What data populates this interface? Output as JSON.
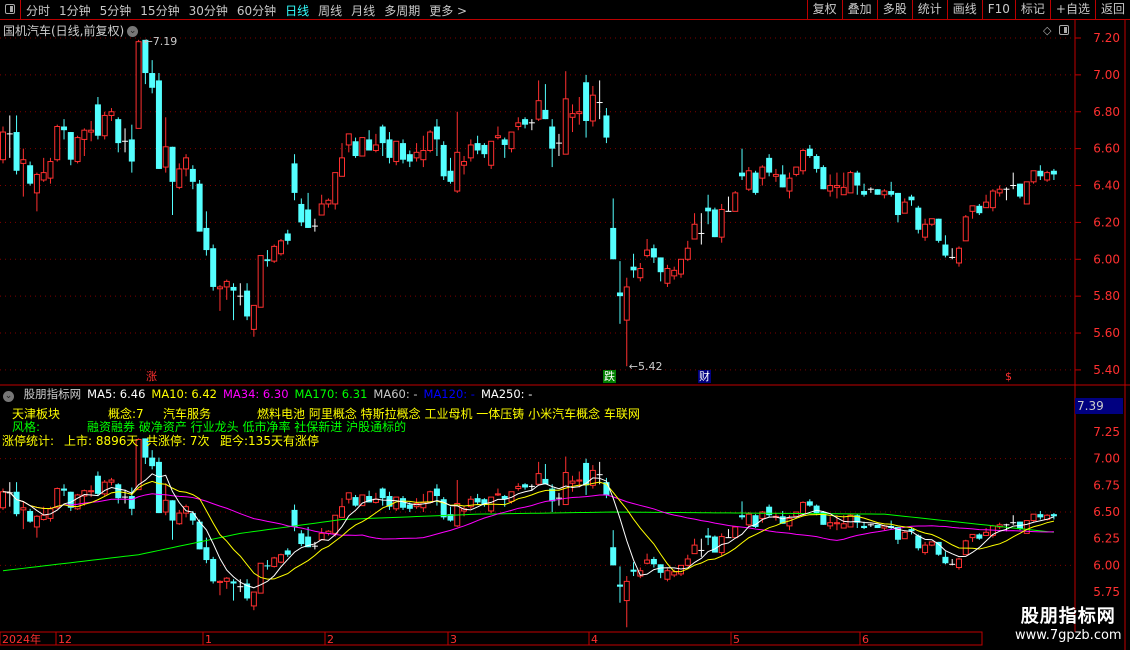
{
  "toolbar": {
    "periods": [
      "分时",
      "1分钟",
      "5分钟",
      "15分钟",
      "30分钟",
      "60分钟",
      "日线",
      "周线",
      "月线",
      "多周期",
      "更多 >"
    ],
    "active_period": "日线",
    "buttons": [
      "复权",
      "叠加",
      "多股",
      "统计",
      "画线",
      "F10",
      "标记",
      "+自选",
      "返回"
    ]
  },
  "main": {
    "title": "国机汽车(日线,前复权)",
    "high_label": "7.19",
    "low_label": "5.42",
    "markers": [
      {
        "text": "涨",
        "color": "#ff3030"
      },
      {
        "text": "跌",
        "color": "#ffffff",
        "bg": "#008000"
      },
      {
        "text": "财",
        "color": "#ffffff",
        "bg": "#000080"
      },
      {
        "text": "$",
        "color": "#ff3030"
      }
    ]
  },
  "indicator": {
    "name": "股朋指标网",
    "ma_labels": [
      {
        "text": "MA5: 6.46",
        "color": "#ffffff"
      },
      {
        "text": "MA10: 6.42",
        "color": "#ffff00"
      },
      {
        "text": "MA34: 6.30",
        "color": "#ff00ff"
      },
      {
        "text": "MA170: 6.31",
        "color": "#00ff00"
      },
      {
        "text": "MA60: -",
        "color": "#c8c8c8"
      },
      {
        "text": "MA120: -",
        "color": "#0000ff"
      },
      {
        "text": "MA250: -",
        "color": "#ffffff"
      }
    ],
    "board": "天津板块",
    "concept_count": "概念:7",
    "industry": "汽车服务",
    "concepts": "燃料电池 阿里概念 特斯拉概念 工业母机 一体压铸 小米汽车概念 车联网",
    "style_label": "风格:",
    "styles": "融资融券 破净资产 行业龙头 低市净率 社保新进 沪股通标的",
    "limit_label": "涨停统计:",
    "listed": "上市: 8896天",
    "limit_total": "共涨停: 7次",
    "since": "距今:135天有涨停",
    "current_value": "7.39"
  },
  "time_axis": [
    "2024年",
    "12",
    "1",
    "2",
    "3",
    "4",
    "5",
    "6"
  ],
  "watermark": {
    "name": "股朋指标网",
    "url": "www.7gpzb.com"
  },
  "colors": {
    "up": "#ff3030",
    "down": "#54ffff",
    "doji": "#ffffff",
    "axis": "#c00000",
    "ma5": "#ffffff",
    "ma10": "#ffff00",
    "ma34": "#ff00ff",
    "ma170": "#00ff00"
  },
  "chart_data": {
    "type": "candlestick",
    "main_axis": {
      "ticks": [
        7.2,
        7.0,
        6.8,
        6.6,
        6.4,
        6.2,
        6.0,
        5.8,
        5.6,
        5.4
      ]
    },
    "sub_axis": {
      "ticks": [
        7.25,
        7.0,
        6.75,
        6.5,
        6.25,
        6.0,
        5.75
      ]
    },
    "ohlc": [
      [
        6.54,
        6.72,
        6.52,
        6.69
      ],
      [
        6.68,
        6.78,
        6.55,
        6.68
      ],
      [
        6.69,
        6.78,
        6.46,
        6.48
      ],
      [
        6.52,
        6.6,
        6.34,
        6.54
      ],
      [
        6.51,
        6.53,
        6.4,
        6.41
      ],
      [
        6.36,
        6.47,
        6.26,
        6.46
      ],
      [
        6.43,
        6.55,
        6.42,
        6.47
      ],
      [
        6.44,
        6.55,
        6.41,
        6.53
      ],
      [
        6.54,
        6.73,
        6.53,
        6.72
      ],
      [
        6.72,
        6.76,
        6.65,
        6.7
      ],
      [
        6.69,
        6.69,
        6.51,
        6.54
      ],
      [
        6.53,
        6.67,
        6.52,
        6.66
      ],
      [
        6.65,
        6.71,
        6.56,
        6.7
      ],
      [
        6.69,
        6.75,
        6.64,
        6.7
      ],
      [
        6.84,
        6.88,
        6.65,
        6.67
      ],
      [
        6.67,
        6.8,
        6.65,
        6.78
      ],
      [
        6.78,
        6.82,
        6.75,
        6.8
      ],
      [
        6.76,
        6.77,
        6.58,
        6.63
      ],
      [
        6.64,
        6.71,
        6.58,
        6.64
      ],
      [
        6.65,
        6.73,
        6.47,
        6.53
      ],
      [
        6.71,
        7.19,
        6.71,
        7.18
      ],
      [
        7.19,
        7.19,
        6.95,
        7.01
      ],
      [
        7.01,
        7.08,
        6.9,
        6.93
      ],
      [
        6.97,
        7.01,
        6.49,
        6.49
      ],
      [
        6.5,
        6.77,
        6.47,
        6.61
      ],
      [
        6.61,
        6.61,
        6.24,
        6.42
      ],
      [
        6.39,
        6.52,
        6.38,
        6.49
      ],
      [
        6.49,
        6.57,
        6.45,
        6.55
      ],
      [
        6.49,
        6.51,
        6.38,
        6.42
      ],
      [
        6.41,
        6.43,
        6.15,
        6.15
      ],
      [
        6.17,
        6.26,
        6.02,
        6.05
      ],
      [
        6.06,
        6.08,
        5.83,
        5.85
      ],
      [
        5.84,
        5.86,
        5.72,
        5.85
      ],
      [
        5.85,
        5.89,
        5.78,
        5.88
      ],
      [
        5.85,
        5.87,
        5.67,
        5.83
      ],
      [
        5.8,
        5.87,
        5.75,
        5.8
      ],
      [
        5.83,
        5.87,
        5.67,
        5.69
      ],
      [
        5.62,
        5.75,
        5.58,
        5.75
      ],
      [
        5.74,
        6.02,
        5.74,
        6.02
      ],
      [
        6.0,
        6.05,
        5.96,
        5.99
      ],
      [
        5.99,
        6.08,
        5.98,
        6.07
      ],
      [
        6.03,
        6.11,
        6.02,
        6.1
      ],
      [
        6.14,
        6.16,
        6.08,
        6.1
      ],
      [
        6.52,
        6.57,
        6.32,
        6.36
      ],
      [
        6.3,
        6.33,
        6.18,
        6.2
      ],
      [
        6.27,
        6.36,
        6.17,
        6.17
      ],
      [
        6.18,
        6.22,
        6.15,
        6.18
      ],
      [
        6.24,
        6.35,
        6.24,
        6.3
      ],
      [
        6.3,
        6.33,
        6.28,
        6.32
      ],
      [
        6.3,
        6.47,
        6.27,
        6.47
      ],
      [
        6.45,
        6.63,
        6.45,
        6.55
      ],
      [
        6.62,
        6.68,
        6.58,
        6.68
      ],
      [
        6.64,
        6.66,
        6.55,
        6.56
      ],
      [
        6.56,
        6.66,
        6.56,
        6.66
      ],
      [
        6.65,
        6.7,
        6.59,
        6.59
      ],
      [
        6.59,
        6.68,
        6.58,
        6.62
      ],
      [
        6.72,
        6.73,
        6.56,
        6.63
      ],
      [
        6.65,
        6.69,
        6.52,
        6.55
      ],
      [
        6.53,
        6.64,
        6.51,
        6.64
      ],
      [
        6.63,
        6.65,
        6.52,
        6.54
      ],
      [
        6.57,
        6.59,
        6.5,
        6.53
      ],
      [
        6.55,
        6.63,
        6.53,
        6.58
      ],
      [
        6.54,
        6.67,
        6.5,
        6.59
      ],
      [
        6.59,
        6.7,
        6.58,
        6.69
      ],
      [
        6.72,
        6.76,
        6.56,
        6.65
      ],
      [
        6.62,
        6.64,
        6.43,
        6.45
      ],
      [
        6.48,
        6.55,
        6.41,
        6.42
      ],
      [
        6.37,
        6.8,
        6.36,
        6.58
      ],
      [
        6.51,
        6.56,
        6.46,
        6.53
      ],
      [
        6.55,
        6.65,
        6.53,
        6.62
      ],
      [
        6.63,
        6.67,
        6.57,
        6.59
      ],
      [
        6.62,
        6.63,
        6.55,
        6.57
      ],
      [
        6.51,
        6.64,
        6.49,
        6.64
      ],
      [
        6.66,
        6.72,
        6.65,
        6.67
      ],
      [
        6.65,
        6.66,
        6.55,
        6.62
      ],
      [
        6.6,
        6.69,
        6.58,
        6.69
      ],
      [
        6.72,
        6.77,
        6.7,
        6.74
      ],
      [
        6.76,
        6.77,
        6.71,
        6.73
      ],
      [
        6.74,
        6.76,
        6.7,
        6.74
      ],
      [
        6.76,
        6.97,
        6.75,
        6.86
      ],
      [
        6.81,
        6.95,
        6.76,
        6.76
      ],
      [
        6.72,
        6.76,
        6.5,
        6.6
      ],
      [
        6.63,
        6.68,
        6.56,
        6.63
      ],
      [
        6.57,
        7.02,
        6.57,
        6.87
      ],
      [
        6.77,
        6.84,
        6.69,
        6.79
      ],
      [
        6.79,
        6.88,
        6.73,
        6.8
      ],
      [
        6.96,
        7.0,
        6.66,
        6.75
      ],
      [
        6.75,
        6.94,
        6.72,
        6.89
      ],
      [
        6.85,
        6.97,
        6.76,
        6.85
      ],
      [
        6.78,
        6.82,
        6.63,
        6.66
      ],
      [
        6.17,
        6.33,
        6.0,
        6.0
      ],
      [
        5.82,
        5.99,
        5.65,
        5.8
      ],
      [
        5.67,
        5.9,
        5.42,
        5.85
      ],
      [
        5.96,
        6.03,
        5.9,
        5.94
      ],
      [
        5.9,
        5.98,
        5.88,
        5.95
      ],
      [
        6.02,
        6.11,
        6.01,
        6.05
      ],
      [
        6.06,
        6.08,
        5.98,
        6.01
      ],
      [
        6.01,
        6.01,
        5.88,
        5.93
      ],
      [
        5.87,
        5.97,
        5.85,
        5.95
      ],
      [
        5.91,
        5.96,
        5.89,
        5.94
      ],
      [
        5.92,
        6.0,
        5.9,
        6.0
      ],
      [
        6.0,
        6.1,
        5.99,
        6.06
      ],
      [
        6.11,
        6.25,
        6.11,
        6.19
      ],
      [
        6.14,
        6.25,
        6.08,
        6.14
      ],
      [
        6.28,
        6.35,
        6.19,
        6.26
      ],
      [
        6.27,
        6.28,
        6.12,
        6.12
      ],
      [
        6.12,
        6.3,
        6.09,
        6.27
      ],
      [
        6.26,
        6.34,
        6.26,
        6.26
      ],
      [
        6.26,
        6.37,
        6.26,
        6.36
      ],
      [
        6.47,
        6.6,
        6.43,
        6.45
      ],
      [
        6.38,
        6.5,
        6.37,
        6.48
      ],
      [
        6.47,
        6.48,
        6.35,
        6.36
      ],
      [
        6.44,
        6.51,
        6.4,
        6.5
      ],
      [
        6.55,
        6.57,
        6.45,
        6.47
      ],
      [
        6.45,
        6.49,
        6.42,
        6.46
      ],
      [
        6.46,
        6.51,
        6.39,
        6.39
      ],
      [
        6.37,
        6.47,
        6.33,
        6.44
      ],
      [
        6.46,
        6.5,
        6.45,
        6.5
      ],
      [
        6.48,
        6.6,
        6.46,
        6.59
      ],
      [
        6.6,
        6.62,
        6.55,
        6.56
      ],
      [
        6.56,
        6.57,
        6.47,
        6.49
      ],
      [
        6.5,
        6.51,
        6.38,
        6.38
      ],
      [
        6.37,
        6.46,
        6.34,
        6.4
      ],
      [
        6.39,
        6.47,
        6.33,
        6.4
      ],
      [
        6.35,
        6.47,
        6.35,
        6.39
      ],
      [
        6.36,
        6.48,
        6.36,
        6.47
      ],
      [
        6.47,
        6.48,
        6.35,
        6.4
      ],
      [
        6.37,
        6.41,
        6.34,
        6.35
      ],
      [
        6.38,
        6.39,
        6.36,
        6.38
      ],
      [
        6.38,
        6.38,
        6.35,
        6.35
      ],
      [
        6.35,
        6.38,
        6.33,
        6.37
      ],
      [
        6.37,
        6.42,
        6.34,
        6.35
      ],
      [
        6.36,
        6.36,
        6.2,
        6.24
      ],
      [
        6.25,
        6.33,
        6.25,
        6.31
      ],
      [
        6.34,
        6.35,
        6.29,
        6.32
      ],
      [
        6.28,
        6.29,
        6.14,
        6.16
      ],
      [
        6.12,
        6.22,
        6.1,
        6.19
      ],
      [
        6.19,
        6.22,
        6.18,
        6.22
      ],
      [
        6.22,
        6.22,
        6.09,
        6.1
      ],
      [
        6.08,
        6.13,
        6.01,
        6.02
      ],
      [
        6.01,
        6.06,
        6.0,
        6.01
      ],
      [
        5.98,
        6.07,
        5.96,
        6.06
      ],
      [
        6.1,
        6.24,
        6.1,
        6.23
      ],
      [
        6.26,
        6.29,
        6.22,
        6.29
      ],
      [
        6.29,
        6.3,
        6.24,
        6.25
      ],
      [
        6.28,
        6.35,
        6.28,
        6.31
      ],
      [
        6.28,
        6.38,
        6.26,
        6.37
      ],
      [
        6.36,
        6.4,
        6.34,
        6.38
      ],
      [
        6.38,
        6.39,
        6.32,
        6.38
      ],
      [
        6.4,
        6.47,
        6.38,
        6.4
      ],
      [
        6.41,
        6.41,
        6.33,
        6.34
      ],
      [
        6.3,
        6.42,
        6.3,
        6.42
      ],
      [
        6.42,
        6.48,
        6.41,
        6.48
      ],
      [
        6.48,
        6.51,
        6.43,
        6.45
      ],
      [
        6.43,
        6.48,
        6.42,
        6.47
      ],
      [
        6.48,
        6.49,
        6.43,
        6.46
      ]
    ],
    "ma170_anchors": [
      [
        0,
        5.95
      ],
      [
        20,
        6.1
      ],
      [
        35,
        6.3
      ],
      [
        50,
        6.43
      ],
      [
        70,
        6.48
      ],
      [
        90,
        6.5
      ],
      [
        130,
        6.48
      ],
      [
        155,
        6.31
      ]
    ],
    "high": 7.19,
    "low": 5.42
  }
}
